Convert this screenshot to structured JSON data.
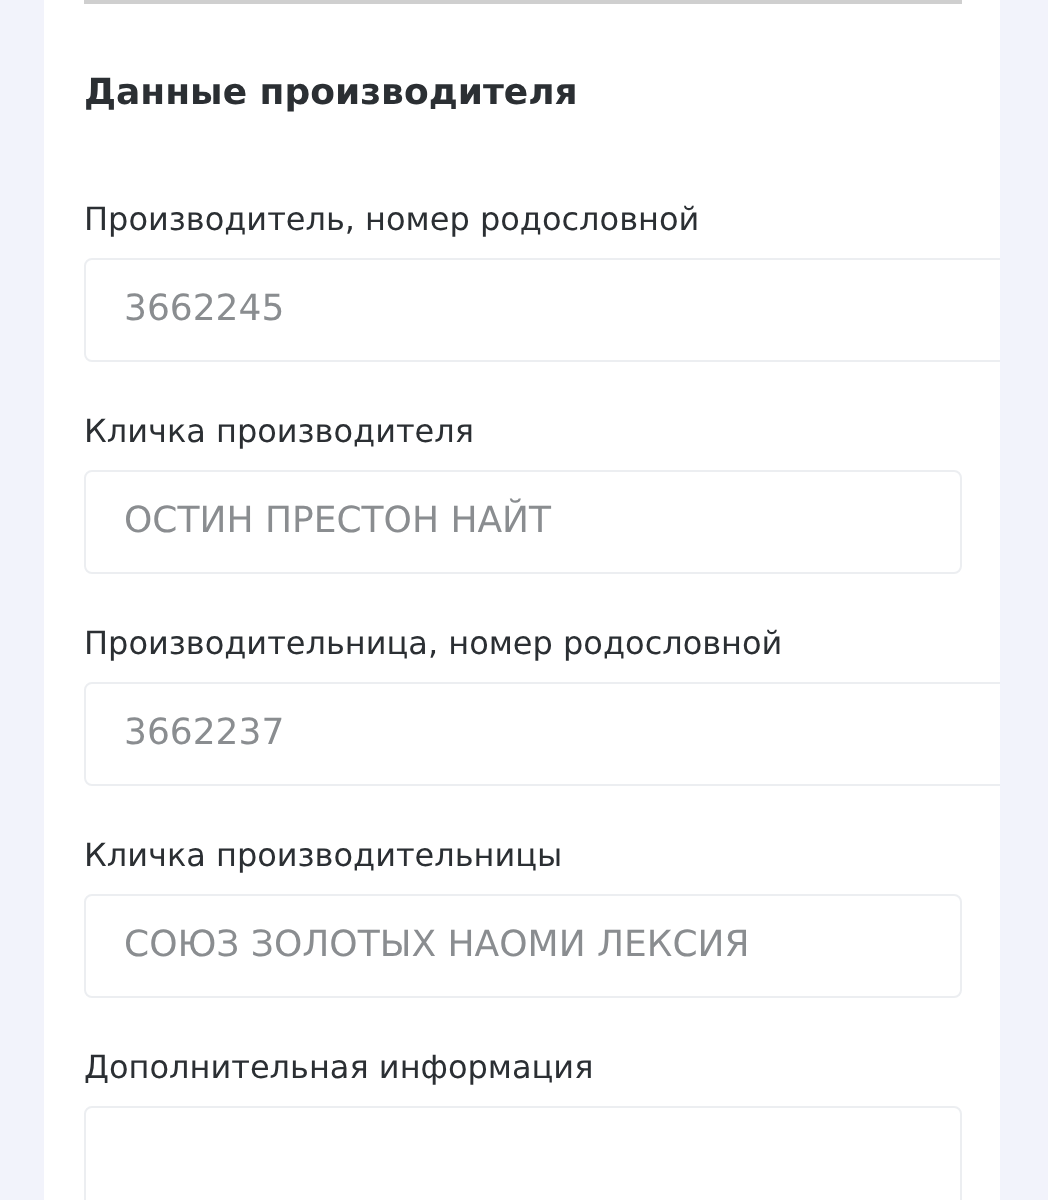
{
  "section": {
    "title": "Данные производителя"
  },
  "fields": [
    {
      "label": "Производитель, номер родословной",
      "value": "3662245",
      "kind": "number"
    },
    {
      "label": "Кличка производителя",
      "value": "ОСТИН ПРЕСТОН НАЙТ",
      "kind": "text"
    },
    {
      "label": "Производительница, номер родословной",
      "value": "3662237",
      "kind": "number"
    },
    {
      "label": "Кличка производительницы",
      "value": "СОЮЗ ЗОЛОТЫХ НАОМИ ЛЕКСИЯ",
      "kind": "text"
    },
    {
      "label": "Дополнительная информация",
      "kind": "textarea"
    }
  ]
}
